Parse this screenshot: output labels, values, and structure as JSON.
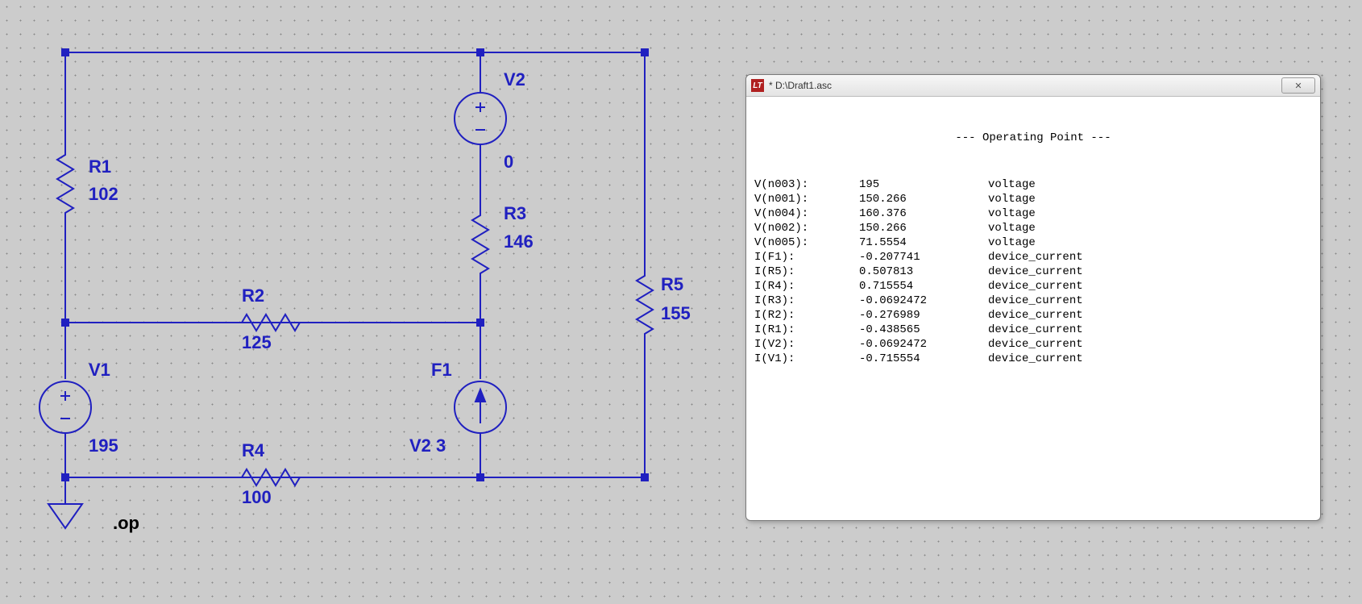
{
  "schematic": {
    "components": {
      "R1": {
        "name": "R1",
        "value": "102"
      },
      "R2": {
        "name": "R2",
        "value": "125"
      },
      "R3": {
        "name": "R3",
        "value": "146"
      },
      "R4": {
        "name": "R4",
        "value": "100"
      },
      "R5": {
        "name": "R5",
        "value": "155"
      },
      "V1": {
        "name": "V1",
        "value": "195"
      },
      "V2": {
        "name": "V2",
        "value": "0"
      },
      "F1": {
        "name": "F1",
        "value": "V2 3"
      }
    },
    "directive": ".op"
  },
  "results": {
    "window_title": "* D:\\Draft1.asc",
    "close_glyph": "✕",
    "header": "--- Operating Point ---",
    "rows": [
      {
        "name": "V(n003):",
        "value": "195",
        "type": "voltage"
      },
      {
        "name": "V(n001):",
        "value": "150.266",
        "type": "voltage"
      },
      {
        "name": "V(n004):",
        "value": "160.376",
        "type": "voltage"
      },
      {
        "name": "V(n002):",
        "value": "150.266",
        "type": "voltage"
      },
      {
        "name": "V(n005):",
        "value": "71.5554",
        "type": "voltage"
      },
      {
        "name": "I(F1):",
        "value": "-0.207741",
        "type": "device_current"
      },
      {
        "name": "I(R5):",
        "value": "0.507813",
        "type": "device_current"
      },
      {
        "name": "I(R4):",
        "value": "0.715554",
        "type": "device_current"
      },
      {
        "name": "I(R3):",
        "value": "-0.0692472",
        "type": "device_current"
      },
      {
        "name": "I(R2):",
        "value": "-0.276989",
        "type": "device_current"
      },
      {
        "name": "I(R1):",
        "value": "-0.438565",
        "type": "device_current"
      },
      {
        "name": "I(V2):",
        "value": "-0.0692472",
        "type": "device_current"
      },
      {
        "name": "I(V1):",
        "value": "-0.715554",
        "type": "device_current"
      }
    ]
  }
}
